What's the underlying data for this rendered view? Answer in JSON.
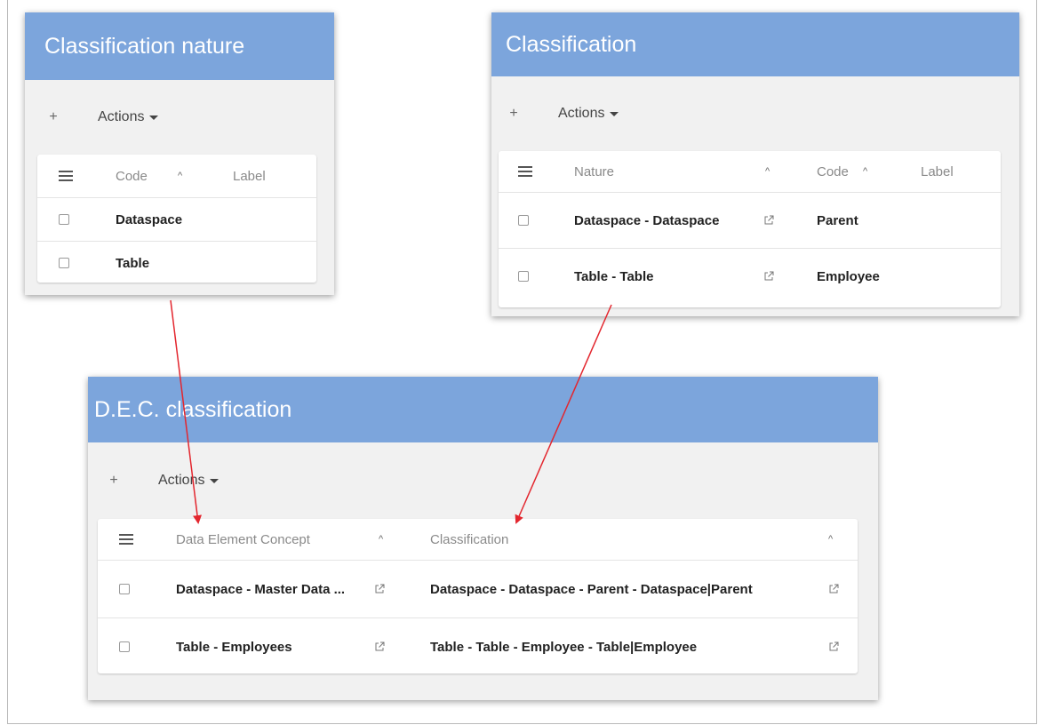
{
  "colors": {
    "header_bg": "#7ca5dc",
    "toolbar_bg": "#f1f1f1",
    "arrow": "#e3262e"
  },
  "panel_nature": {
    "title": "Classification nature",
    "add_label": "+",
    "actions_label": "Actions",
    "columns": [
      "Code",
      "Label"
    ],
    "rows": [
      {
        "code": "Dataspace",
        "label": ""
      },
      {
        "code": "Table",
        "label": ""
      }
    ]
  },
  "panel_classification": {
    "title": "Classification",
    "add_label": "+",
    "actions_label": "Actions",
    "columns": [
      "Nature",
      "Code",
      "Label"
    ],
    "rows": [
      {
        "nature": "Dataspace - Dataspace",
        "code": "Parent",
        "label": ""
      },
      {
        "nature": "Table - Table",
        "code": "Employee",
        "label": ""
      }
    ]
  },
  "panel_dec": {
    "title": "D.E.C. classification",
    "add_label": "+",
    "actions_label": "Actions",
    "columns": [
      "Data Element Concept",
      "Classification"
    ],
    "rows": [
      {
        "concept": "Dataspace - Master Data ...",
        "classification": "Dataspace - Dataspace - Parent - Dataspace|Parent"
      },
      {
        "concept": "Table - Employees",
        "classification": "Table - Table - Employee - Table|Employee"
      }
    ]
  },
  "icons": {
    "menu": "hamburger-menu-icon",
    "sort_up": "chevron-up-icon",
    "dropdown": "caret-down-icon",
    "external": "external-link-icon",
    "checkbox": "checkbox-icon"
  }
}
